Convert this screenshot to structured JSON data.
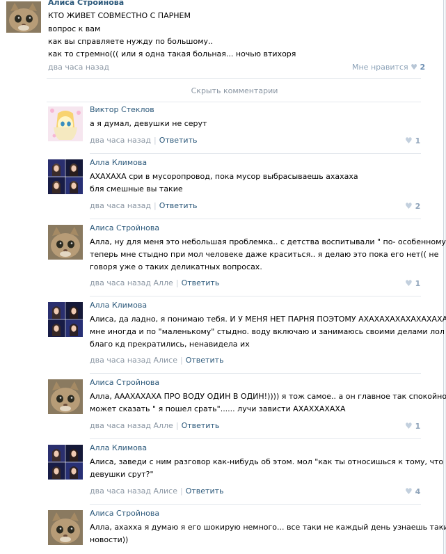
{
  "post": {
    "author": "Алиса Стройнова",
    "lines": [
      "КТО ЖИВЕТ СОВМЕСТНО С ПАРНЕМ",
      "вопрос к вам",
      "как вы справляете нужду по большому..",
      "как то стремно((( или я одна такая больная... ночью втихоря"
    ],
    "time": "два часа назад",
    "like_label": "Мне нравится",
    "like_count": "2"
  },
  "hide_comments": "Скрыть комментарии",
  "comments": [
    {
      "author": "Виктор Стеклов",
      "avatar": "pony",
      "lines": [
        "а я думал, девушки не серут"
      ],
      "time": "два часа назад",
      "reply": "Ответить",
      "likes": "1"
    },
    {
      "author": "Алла Климова",
      "avatar": "girl",
      "lines": [
        "АХАХАХА сри в мусоропровод, пока мусор выбрасываешь ахахаха",
        "бля смешные вы такие"
      ],
      "time": "два часа назад",
      "reply": "Ответить",
      "likes": "2"
    },
    {
      "author": "Алиса Стройнова",
      "avatar": "cat",
      "lines": [
        "Алла, ну для меня это небольшая проблемка.. с детства воспитывали \" по- особенному\"..",
        "теперь мне стыдно при мол человеке даже краситься.. я делаю это пока его нет(( не",
        "говоря уже о таких деликатных вопросах."
      ],
      "time": "два часа назад Алле",
      "reply": "Ответить",
      "likes": "1"
    },
    {
      "author": "Алла Климова",
      "avatar": "girl",
      "lines": [
        "Алиса, да ладно, я понимаю тебя. И У МЕНЯ НЕТ ПАРНЯ ПОЭТОМУ АХАХАХАХАХАХАХАХА",
        "мне иногда и по \"маленькому\" стыдно. воду включаю и занимаюсь своими делами лол",
        "благо кд прекратились, ненавидела их"
      ],
      "time": "два часа назад Алисе",
      "reply": "Ответить",
      "likes": ""
    },
    {
      "author": "Алиса Стройнова",
      "avatar": "cat",
      "lines": [
        "Алла, АААХАХАХА ПРО ВОДУ ОДИН В ОДИН!)))) я тож самое.. а он главное так спокойно",
        "может сказать \" я пошел срать\"...... лучи зависти АХАХХАХАХА"
      ],
      "time": "два часа назад Алле",
      "reply": "Ответить",
      "likes": "1"
    },
    {
      "author": "Алла Климова",
      "avatar": "girl",
      "lines": [
        "Алиса, заведи с ним разговор как-нибудь об этом. мол \"как ты относишься к тому, что",
        "девушки срут?\""
      ],
      "time": "два часа назад Алисе",
      "reply": "Ответить",
      "likes": "4"
    },
    {
      "author": "Алиса Стройнова",
      "avatar": "cat",
      "lines": [
        "Алла, ахахха я думаю я его шокирую немного... все таки не каждый день узнаешь такие",
        "новости))"
      ],
      "time": "",
      "reply": "",
      "likes": ""
    }
  ],
  "colors": {
    "link": "#2b587a",
    "meta": "#8a96a3",
    "separator": "#e4e8ed"
  }
}
